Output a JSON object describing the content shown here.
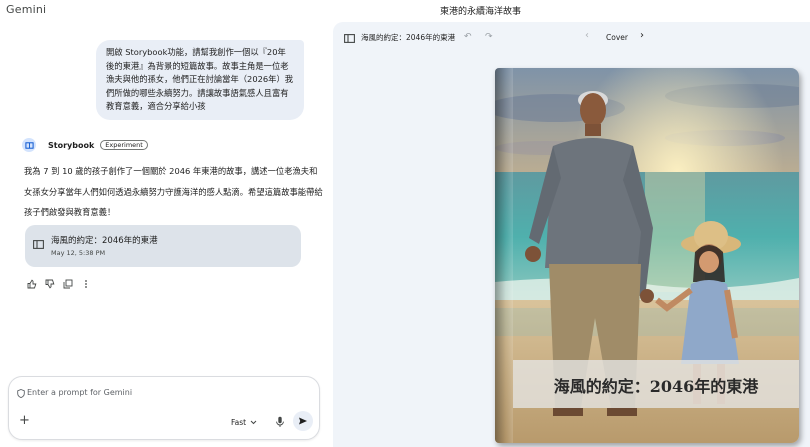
{
  "app": {
    "name": "Gemini"
  },
  "header": {
    "title": "東港的永續海洋故事"
  },
  "chat": {
    "user_message": "開啟 Storybook功能，請幫我創作一個以『20年後的東港』為背景的短篇故事。故事主角是一位老漁夫與他的孫女，他們正在討論當年（2026年）我們所做的哪些永續努力。請讓故事語氣感人且富有教育意義，適合分享給小孩",
    "assistant": {
      "name": "Storybook",
      "badge": "Experiment",
      "reply": "我為 7 到 10 歲的孩子創作了一個關於 2046 年東港的故事，講述一位老漁夫和女孫女分享當年人們如何透過永續努力守護海洋的感人點滴。希望這篇故事能帶給孩子們啟發與教育意義！",
      "card": {
        "title": "海風的約定：2046年的東港",
        "time": "May 12, 5:38 PM"
      },
      "actions": [
        "thumb-up-icon",
        "thumb-down-icon",
        "copy-icon",
        "more-icon"
      ]
    }
  },
  "prompt": {
    "placeholder": "Enter a prompt for Gemini",
    "mode": "Fast"
  },
  "storybook": {
    "toolbar_title": "海風的約定：2046年的東港",
    "page_label": "Cover",
    "cover_title": "海風的約定：2046年的東港"
  },
  "colors": {
    "accent": "#0b57d0",
    "panel": "#f0f4f9",
    "bubble": "#e9eef6",
    "card": "#dde3ea"
  }
}
